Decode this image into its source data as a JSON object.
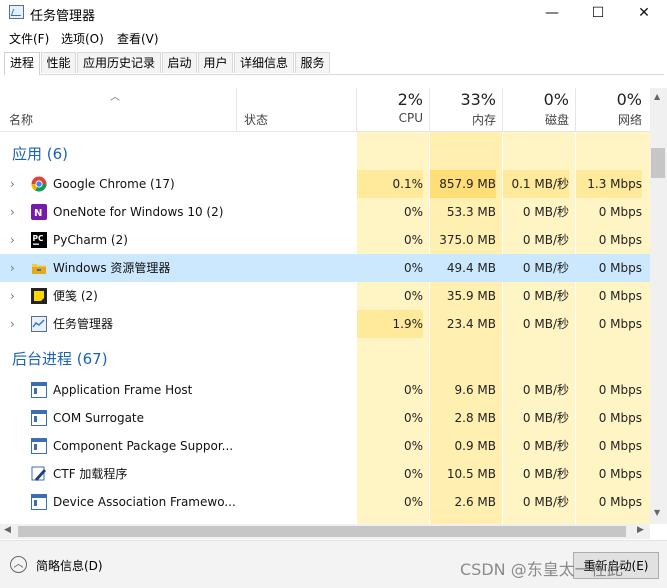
{
  "window": {
    "title": "任务管理器",
    "minimize": "—",
    "maximize": "☐",
    "close": "✕"
  },
  "menu": [
    "文件(F)",
    "选项(O)",
    "查看(V)"
  ],
  "tabs": [
    "进程",
    "性能",
    "应用历史记录",
    "启动",
    "用户",
    "详细信息",
    "服务"
  ],
  "header": {
    "name": "名称",
    "status": "状态",
    "cpu_pct": "2%",
    "cpu": "CPU",
    "mem_pct": "33%",
    "mem": "内存",
    "disk_pct": "0%",
    "disk": "磁盘",
    "net_pct": "0%",
    "net": "网络"
  },
  "groups": [
    {
      "title": "应用 (6)",
      "rows": [
        {
          "name": "Google Chrome (17)",
          "icon": "chrome-icon",
          "cpu": "0.1%",
          "mem": "857.9 MB",
          "disk": "0.1 MB/秒",
          "net": "1.3 Mbps",
          "expandable": true
        },
        {
          "name": "OneNote for Windows 10 (2)",
          "icon": "onenote-icon",
          "cpu": "0%",
          "mem": "53.3 MB",
          "disk": "0 MB/秒",
          "net": "0 Mbps",
          "expandable": true
        },
        {
          "name": "PyCharm (2)",
          "icon": "pycharm-icon",
          "cpu": "0%",
          "mem": "375.0 MB",
          "disk": "0 MB/秒",
          "net": "0 Mbps",
          "expandable": true
        },
        {
          "name": "Windows 资源管理器",
          "icon": "folder-icon",
          "cpu": "0%",
          "mem": "49.4 MB",
          "disk": "0 MB/秒",
          "net": "0 Mbps",
          "expandable": true,
          "selected": true
        },
        {
          "name": "便笺 (2)",
          "icon": "sticky-notes-icon",
          "cpu": "0%",
          "mem": "35.9 MB",
          "disk": "0 MB/秒",
          "net": "0 Mbps",
          "expandable": true
        },
        {
          "name": "任务管理器",
          "icon": "task-manager-icon",
          "cpu": "1.9%",
          "mem": "23.4 MB",
          "disk": "0 MB/秒",
          "net": "0 Mbps",
          "expandable": true
        }
      ]
    },
    {
      "title": "后台进程 (67)",
      "rows": [
        {
          "name": "Application Frame Host",
          "icon": "window-icon",
          "cpu": "0%",
          "mem": "9.6 MB",
          "disk": "0 MB/秒",
          "net": "0 Mbps",
          "expandable": false
        },
        {
          "name": "COM Surrogate",
          "icon": "window-icon",
          "cpu": "0%",
          "mem": "2.8 MB",
          "disk": "0 MB/秒",
          "net": "0 Mbps",
          "expandable": false
        },
        {
          "name": "Component Package Suppor...",
          "icon": "window-icon",
          "cpu": "0%",
          "mem": "0.9 MB",
          "disk": "0 MB/秒",
          "net": "0 Mbps",
          "expandable": false
        },
        {
          "name": "CTF 加载程序",
          "icon": "pen-icon",
          "cpu": "0%",
          "mem": "10.5 MB",
          "disk": "0 MB/秒",
          "net": "0 Mbps",
          "expandable": false
        },
        {
          "name": "Device Association Framewo...",
          "icon": "window-icon",
          "cpu": "0%",
          "mem": "2.6 MB",
          "disk": "0 MB/秒",
          "net": "0 Mbps",
          "expandable": false
        }
      ]
    }
  ],
  "footer": {
    "fewer_details": "简略信息(D)",
    "end_task": "重新启动(E)",
    "watermark": "CSDN @东皇太一在此"
  },
  "colors": {
    "accent": "#1a63b6",
    "selected": "#cce8ff",
    "heat_light": "#fff4c4",
    "heat_mid": "#ffe99a"
  }
}
